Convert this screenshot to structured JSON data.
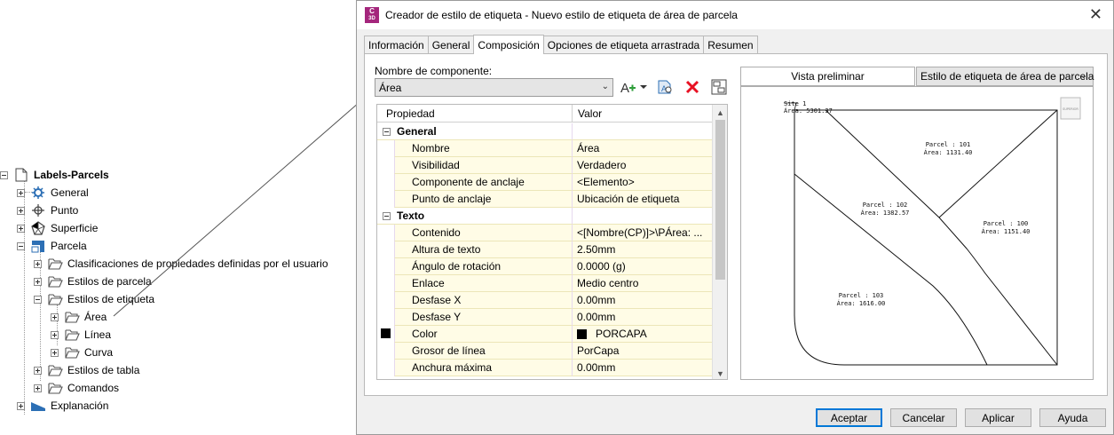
{
  "tree": {
    "root": "Labels-Parcels",
    "items": [
      {
        "label": "General"
      },
      {
        "label": "Punto"
      },
      {
        "label": "Superficie"
      },
      {
        "label": "Parcela"
      },
      {
        "label": "Clasificaciones de propiedades definidas por el usuario"
      },
      {
        "label": "Estilos de parcela"
      },
      {
        "label": "Estilos de etiqueta"
      },
      {
        "label": "Área"
      },
      {
        "label": "Línea"
      },
      {
        "label": "Curva"
      },
      {
        "label": "Estilos de tabla"
      },
      {
        "label": "Comandos"
      },
      {
        "label": "Explanación"
      }
    ]
  },
  "dialog": {
    "app_icon_text": [
      "C",
      "3D"
    ],
    "title": "Creador de estilo de etiqueta - Nuevo estilo de etiqueta de área de parcela",
    "close_glyph": "✕",
    "tabs": [
      "Información",
      "General",
      "Composición",
      "Opciones de etiqueta arrastrada",
      "Resumen"
    ],
    "active_tab": "Composición",
    "component_label": "Nombre de componente:",
    "component_value": "Área",
    "grid": {
      "col_property": "Propiedad",
      "col_value": "Valor",
      "categories": [
        {
          "name": "General",
          "rows": [
            {
              "prop": "Nombre",
              "value": "Área"
            },
            {
              "prop": "Visibilidad",
              "value": "Verdadero"
            },
            {
              "prop": "Componente de anclaje",
              "value": "<Elemento>"
            },
            {
              "prop": "Punto de anclaje",
              "value": "Ubicación de etiqueta"
            }
          ]
        },
        {
          "name": "Texto",
          "rows": [
            {
              "prop": "Contenido",
              "value": "<[Nombre(CP)]>\\PÁrea: ..."
            },
            {
              "prop": "Altura de texto",
              "value": "2.50mm"
            },
            {
              "prop": "Ángulo de rotación",
              "value": "0.0000 (g)"
            },
            {
              "prop": "Enlace",
              "value": "Medio centro"
            },
            {
              "prop": "Desfase X",
              "value": "0.00mm"
            },
            {
              "prop": "Desfase Y",
              "value": "0.00mm"
            },
            {
              "prop": "Color",
              "value": "PORCAPA"
            },
            {
              "prop": "Grosor de línea",
              "value": "PorCapa"
            },
            {
              "prop": "Anchura máxima",
              "value": "0.00mm"
            }
          ]
        }
      ]
    },
    "preview_button": "Vista preliminar",
    "preview_style": "Estilo de etiqueta de área de parcela",
    "preview_labels": {
      "site_name": "Site 1",
      "site_area": "Área: 5301.37",
      "p101_name": "Parcel : 101",
      "p101_area": "Área: 1131.40",
      "p102_name": "Parcel : 102",
      "p102_area": "Área: 1382.57",
      "p100_name": "Parcel : 100",
      "p100_area": "Área: 1151.40",
      "p103_name": "Parcel : 103",
      "p103_area": "Área: 1616.00",
      "view_cube": "SUPERIOR"
    },
    "buttons": {
      "ok": "Aceptar",
      "cancel": "Cancelar",
      "apply": "Aplicar",
      "help": "Ayuda"
    }
  },
  "colors": {
    "accent": "#0078d7",
    "grid_cell": "#fffce6",
    "app_icon": "#a4267c",
    "delete_red": "#e81123"
  }
}
